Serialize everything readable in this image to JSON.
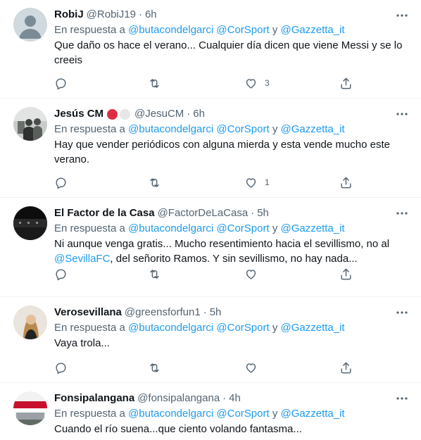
{
  "tweets": [
    {
      "name": "RobiJ",
      "handle": "@RobiJ19",
      "time": "6h",
      "reply_prefix": "En respuesta a",
      "reply_user1": "@butacondelgarci",
      "reply_user2": "@CorSport",
      "reply_and": "y",
      "reply_user3": "@Gazzetta_it",
      "text_line1": "Que daño os hace el verano... Cualquier día dicen que viene Messi y se lo",
      "text_line2": "creeis",
      "likes": "3"
    },
    {
      "name": "Jesús CM",
      "handle": "@JesuCM",
      "time": "6h",
      "reply_prefix": "En respuesta a",
      "reply_user1": "@butacondelgarci",
      "reply_user2": "@CorSport",
      "reply_and": "y",
      "reply_user3": "@Gazzetta_it",
      "text_line1": "Hay que vender periódicos con alguna mierda y esta vende mucho este",
      "text_line2": "verano.",
      "likes": "1",
      "badge_colors": [
        "#dd2e44",
        "#e6e7e8"
      ]
    },
    {
      "name": "El Factor de la Casa",
      "handle": "@FactorDeLaCasa",
      "time": "5h",
      "reply_prefix": "En respuesta a",
      "reply_user1": "@butacondelgarci",
      "reply_user2": "@CorSport",
      "reply_and": "y",
      "reply_user3": "@Gazzetta_it",
      "text_line1": "Ni aunque venga gratis... Mucho resentimiento hacia el sevillismo, no al",
      "text_mention": "@SevillaFC",
      "text_line2_rest": ", del señorito Ramos. Y sin sevillismo, no hay nada..."
    },
    {
      "name": "Verosevillana",
      "handle": "@greensforfun1",
      "time": "5h",
      "reply_prefix": "En respuesta a",
      "reply_user1": "@butacondelgarci",
      "reply_user2": "@CorSport",
      "reply_and": "y",
      "reply_user3": "@Gazzetta_it",
      "text_line1": "Vaya trola..."
    },
    {
      "name": "Fonsipalangana",
      "handle": "@fonsipalangana",
      "time": "4h",
      "reply_prefix": "En respuesta a",
      "reply_user1": "@butacondelgarci",
      "reply_user2": "@CorSport",
      "reply_and": "y",
      "reply_user3": "@Gazzetta_it",
      "text_line1": "Cuando el río suena...que ciento volando fantasma..."
    }
  ],
  "separator": "·",
  "colors": {
    "link": "#1d9bf0",
    "muted": "#536471",
    "text": "#0f1419",
    "border": "#eff3f4"
  },
  "icons": [
    "more-icon",
    "reply-icon",
    "retweet-icon",
    "like-icon",
    "share-icon"
  ]
}
